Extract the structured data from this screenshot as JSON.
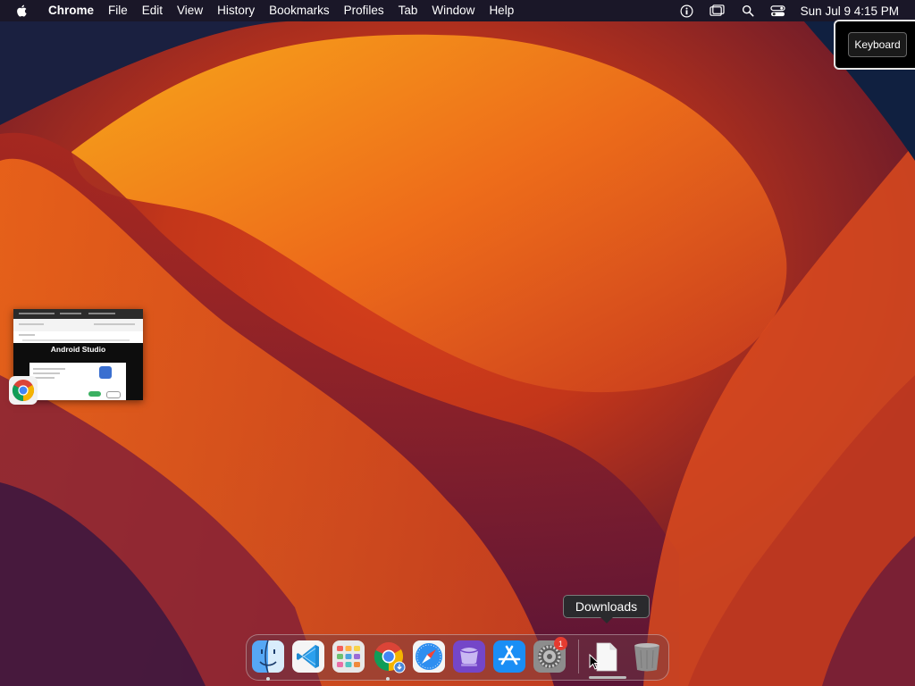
{
  "menubar": {
    "app_name": "Chrome",
    "menus": [
      "File",
      "Edit",
      "View",
      "History",
      "Bookmarks",
      "Profiles",
      "Tab",
      "Window",
      "Help"
    ],
    "status_icons": [
      "accessibility-icon",
      "screen-mirroring-icon",
      "spotlight-search-icon",
      "control-center-icon"
    ],
    "clock": "Sun Jul 9  4:15 PM"
  },
  "keyboard_panel": {
    "button_label": "Keyboard"
  },
  "window_thumbnail": {
    "page_title": "Android Studio",
    "app_icon": "chrome-icon"
  },
  "dock": {
    "tooltip": "Downloads",
    "items": [
      {
        "name": "Finder",
        "icon": "finder-icon",
        "running": true
      },
      {
        "name": "Visual Studio Code",
        "icon": "vscode-icon",
        "running": false
      },
      {
        "name": "Launchpad",
        "icon": "launchpad-icon",
        "running": false
      },
      {
        "name": "Google Chrome",
        "icon": "chrome-icon",
        "running": true
      },
      {
        "name": "Safari",
        "icon": "safari-icon",
        "running": false
      },
      {
        "name": "Simulator",
        "icon": "simulator-icon",
        "running": false
      },
      {
        "name": "App Store",
        "icon": "app-store-icon",
        "running": false
      },
      {
        "name": "System Settings",
        "icon": "system-settings-icon",
        "running": false,
        "badge": "1"
      },
      {
        "name": "Downloads",
        "icon": "downloads-stack-icon"
      },
      {
        "name": "Trash",
        "icon": "trash-icon"
      }
    ]
  },
  "colors": {
    "badge_red": "#e53b30",
    "menubar_text": "#ffffff"
  }
}
